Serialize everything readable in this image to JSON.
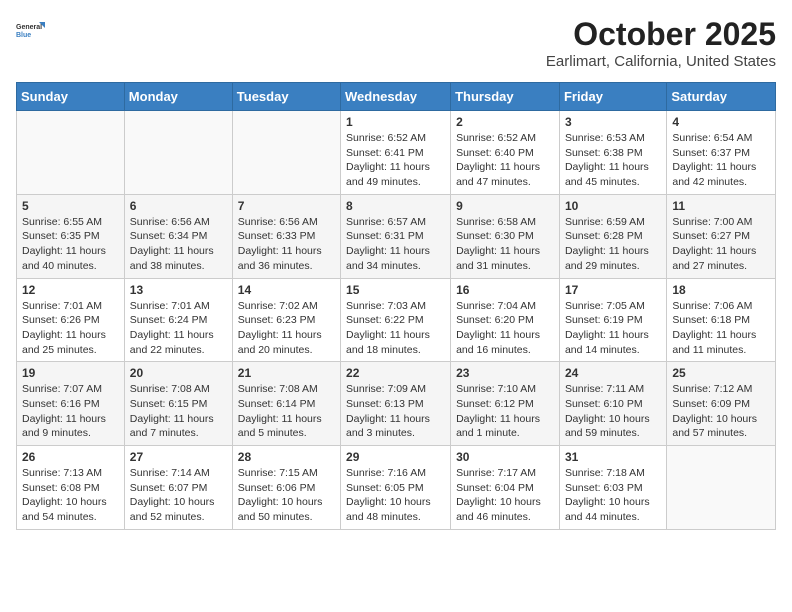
{
  "header": {
    "logo": {
      "general": "General",
      "blue": "Blue"
    },
    "title": "October 2025",
    "subtitle": "Earlimart, California, United States"
  },
  "days_of_week": [
    "Sunday",
    "Monday",
    "Tuesday",
    "Wednesday",
    "Thursday",
    "Friday",
    "Saturday"
  ],
  "weeks": [
    [
      {
        "num": "",
        "info": ""
      },
      {
        "num": "",
        "info": ""
      },
      {
        "num": "",
        "info": ""
      },
      {
        "num": "1",
        "info": "Sunrise: 6:52 AM\nSunset: 6:41 PM\nDaylight: 11 hours and 49 minutes."
      },
      {
        "num": "2",
        "info": "Sunrise: 6:52 AM\nSunset: 6:40 PM\nDaylight: 11 hours and 47 minutes."
      },
      {
        "num": "3",
        "info": "Sunrise: 6:53 AM\nSunset: 6:38 PM\nDaylight: 11 hours and 45 minutes."
      },
      {
        "num": "4",
        "info": "Sunrise: 6:54 AM\nSunset: 6:37 PM\nDaylight: 11 hours and 42 minutes."
      }
    ],
    [
      {
        "num": "5",
        "info": "Sunrise: 6:55 AM\nSunset: 6:35 PM\nDaylight: 11 hours and 40 minutes."
      },
      {
        "num": "6",
        "info": "Sunrise: 6:56 AM\nSunset: 6:34 PM\nDaylight: 11 hours and 38 minutes."
      },
      {
        "num": "7",
        "info": "Sunrise: 6:56 AM\nSunset: 6:33 PM\nDaylight: 11 hours and 36 minutes."
      },
      {
        "num": "8",
        "info": "Sunrise: 6:57 AM\nSunset: 6:31 PM\nDaylight: 11 hours and 34 minutes."
      },
      {
        "num": "9",
        "info": "Sunrise: 6:58 AM\nSunset: 6:30 PM\nDaylight: 11 hours and 31 minutes."
      },
      {
        "num": "10",
        "info": "Sunrise: 6:59 AM\nSunset: 6:28 PM\nDaylight: 11 hours and 29 minutes."
      },
      {
        "num": "11",
        "info": "Sunrise: 7:00 AM\nSunset: 6:27 PM\nDaylight: 11 hours and 27 minutes."
      }
    ],
    [
      {
        "num": "12",
        "info": "Sunrise: 7:01 AM\nSunset: 6:26 PM\nDaylight: 11 hours and 25 minutes."
      },
      {
        "num": "13",
        "info": "Sunrise: 7:01 AM\nSunset: 6:24 PM\nDaylight: 11 hours and 22 minutes."
      },
      {
        "num": "14",
        "info": "Sunrise: 7:02 AM\nSunset: 6:23 PM\nDaylight: 11 hours and 20 minutes."
      },
      {
        "num": "15",
        "info": "Sunrise: 7:03 AM\nSunset: 6:22 PM\nDaylight: 11 hours and 18 minutes."
      },
      {
        "num": "16",
        "info": "Sunrise: 7:04 AM\nSunset: 6:20 PM\nDaylight: 11 hours and 16 minutes."
      },
      {
        "num": "17",
        "info": "Sunrise: 7:05 AM\nSunset: 6:19 PM\nDaylight: 11 hours and 14 minutes."
      },
      {
        "num": "18",
        "info": "Sunrise: 7:06 AM\nSunset: 6:18 PM\nDaylight: 11 hours and 11 minutes."
      }
    ],
    [
      {
        "num": "19",
        "info": "Sunrise: 7:07 AM\nSunset: 6:16 PM\nDaylight: 11 hours and 9 minutes."
      },
      {
        "num": "20",
        "info": "Sunrise: 7:08 AM\nSunset: 6:15 PM\nDaylight: 11 hours and 7 minutes."
      },
      {
        "num": "21",
        "info": "Sunrise: 7:08 AM\nSunset: 6:14 PM\nDaylight: 11 hours and 5 minutes."
      },
      {
        "num": "22",
        "info": "Sunrise: 7:09 AM\nSunset: 6:13 PM\nDaylight: 11 hours and 3 minutes."
      },
      {
        "num": "23",
        "info": "Sunrise: 7:10 AM\nSunset: 6:12 PM\nDaylight: 11 hours and 1 minute."
      },
      {
        "num": "24",
        "info": "Sunrise: 7:11 AM\nSunset: 6:10 PM\nDaylight: 10 hours and 59 minutes."
      },
      {
        "num": "25",
        "info": "Sunrise: 7:12 AM\nSunset: 6:09 PM\nDaylight: 10 hours and 57 minutes."
      }
    ],
    [
      {
        "num": "26",
        "info": "Sunrise: 7:13 AM\nSunset: 6:08 PM\nDaylight: 10 hours and 54 minutes."
      },
      {
        "num": "27",
        "info": "Sunrise: 7:14 AM\nSunset: 6:07 PM\nDaylight: 10 hours and 52 minutes."
      },
      {
        "num": "28",
        "info": "Sunrise: 7:15 AM\nSunset: 6:06 PM\nDaylight: 10 hours and 50 minutes."
      },
      {
        "num": "29",
        "info": "Sunrise: 7:16 AM\nSunset: 6:05 PM\nDaylight: 10 hours and 48 minutes."
      },
      {
        "num": "30",
        "info": "Sunrise: 7:17 AM\nSunset: 6:04 PM\nDaylight: 10 hours and 46 minutes."
      },
      {
        "num": "31",
        "info": "Sunrise: 7:18 AM\nSunset: 6:03 PM\nDaylight: 10 hours and 44 minutes."
      },
      {
        "num": "",
        "info": ""
      }
    ]
  ]
}
